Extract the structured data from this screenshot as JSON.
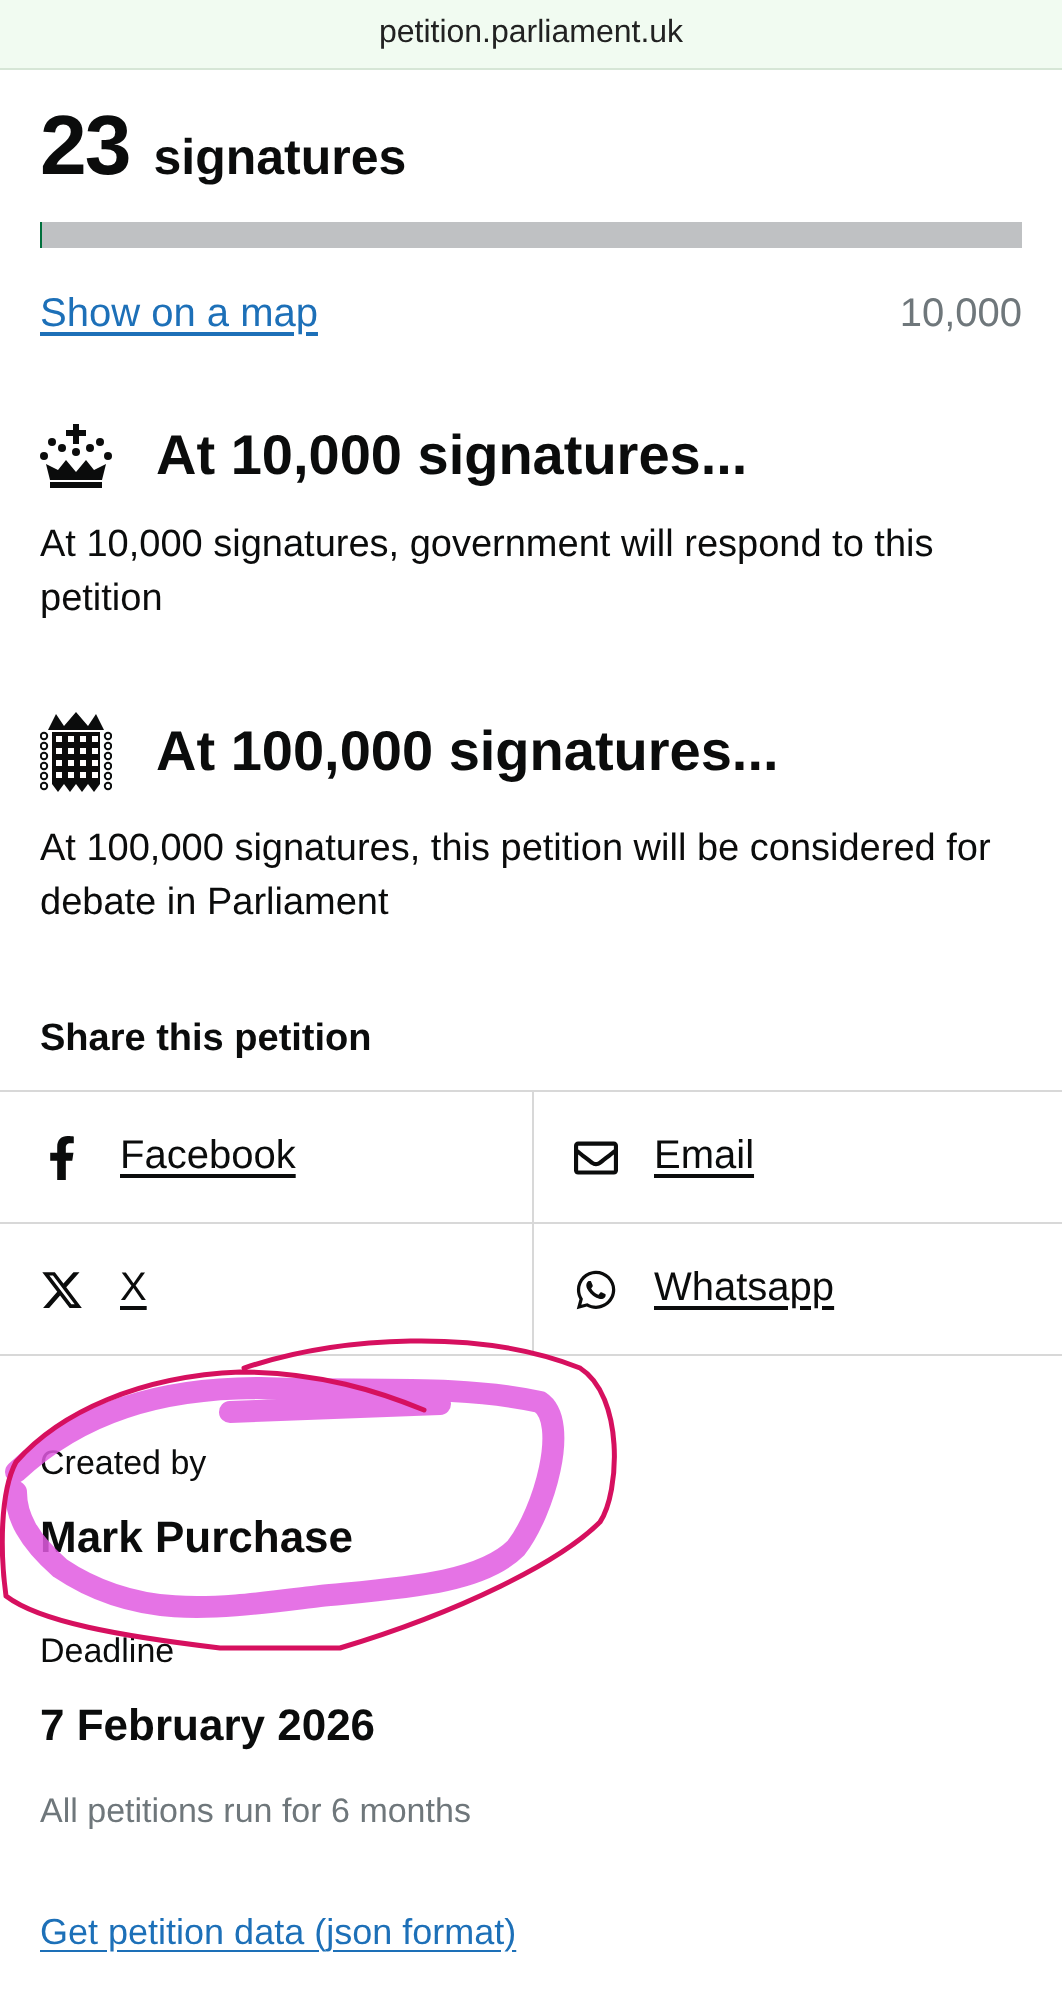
{
  "address_bar": {
    "url": "petition.parliament.uk"
  },
  "signatures": {
    "count": "23",
    "label": "signatures",
    "level": 0.0023,
    "map_link": "Show on a map",
    "target": "10,000"
  },
  "milestones": [
    {
      "kind": "crown",
      "heading": "At 10,000 signatures...",
      "text": "At 10,000 signatures, government will respond to this petition"
    },
    {
      "kind": "portcullis",
      "heading": "At 100,000 signatures...",
      "text": "At 100,000 signatures, this petition will be considered for debate in Parliament"
    }
  ],
  "share": {
    "heading": "Share this petition",
    "links": [
      {
        "kind": "facebook",
        "label": "Facebook"
      },
      {
        "kind": "email",
        "label": "Email"
      },
      {
        "kind": "x",
        "label": "X"
      },
      {
        "kind": "whatsapp",
        "label": "Whatsapp"
      }
    ]
  },
  "creator": {
    "label": "Created by",
    "name": "Mark Purchase"
  },
  "deadline": {
    "label": "Deadline",
    "date": "7 February 2026",
    "note": "All petitions run for 6 months"
  },
  "data_link": "Get petition data (json format)"
}
